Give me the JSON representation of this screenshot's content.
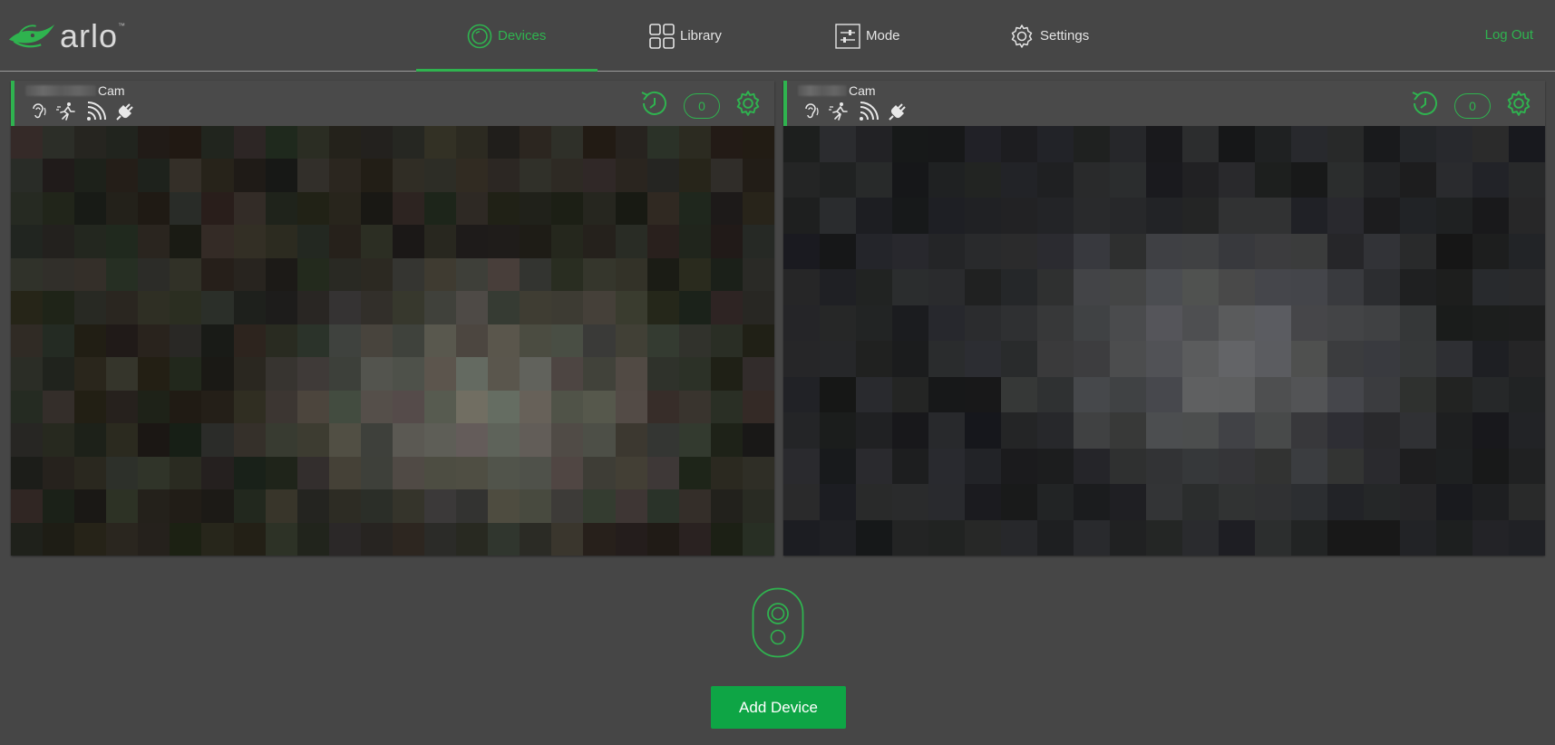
{
  "header": {
    "logo_text": "arlo",
    "logo_tm": "™",
    "nav": [
      {
        "label": "Devices",
        "icon": "devices-icon",
        "active": true
      },
      {
        "label": "Library",
        "icon": "library-grid-icon",
        "active": false
      },
      {
        "label": "Mode",
        "icon": "mode-sliders-icon",
        "active": false
      },
      {
        "label": "Settings",
        "icon": "gear-icon",
        "active": false
      }
    ],
    "logout_label": "Log Out"
  },
  "cameras": [
    {
      "name_suffix": "Cam",
      "clip_count": "0",
      "status_icons": [
        "audio-ear-icon",
        "motion-run-icon",
        "signal-icon",
        "power-plug-icon"
      ]
    },
    {
      "name_suffix": "Cam",
      "clip_count": "0",
      "status_icons": [
        "audio-ear-icon",
        "motion-run-icon",
        "signal-icon",
        "power-plug-icon"
      ]
    }
  ],
  "add_device_label": "Add Device",
  "colors": {
    "accent": "#2fb34f",
    "button": "#0ea545",
    "background": "#464646"
  }
}
